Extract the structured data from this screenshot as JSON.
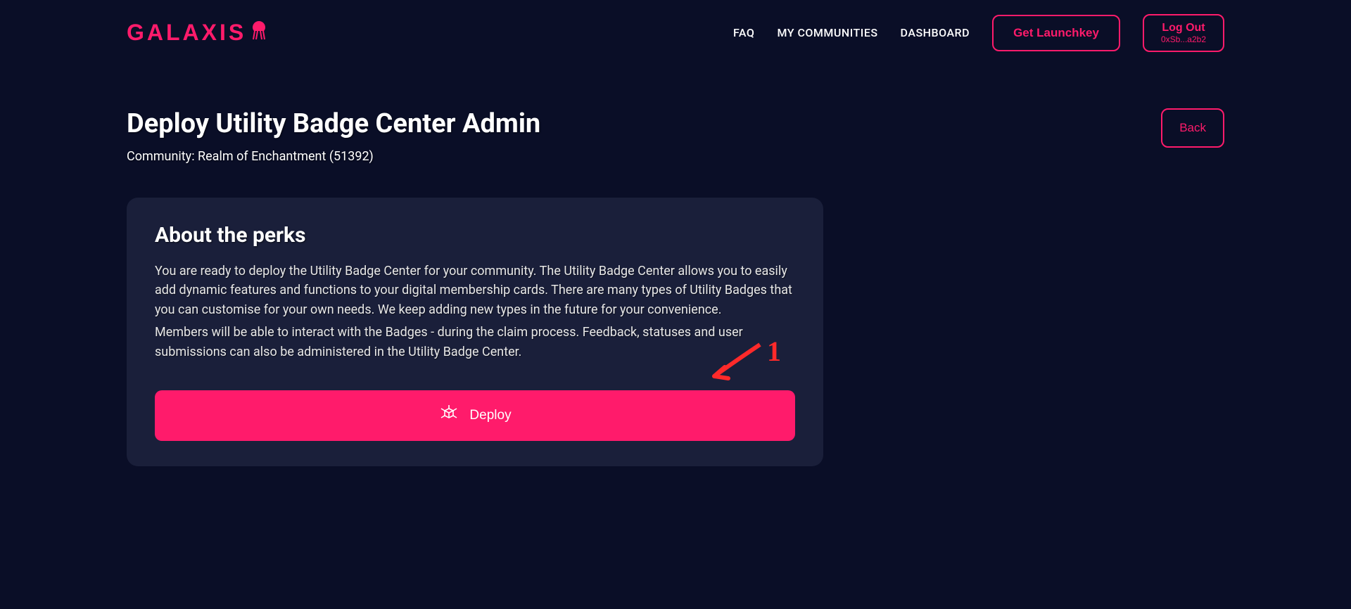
{
  "logo": {
    "text": "GALAXIS"
  },
  "nav": {
    "faq": "FAQ",
    "my_communities": "MY COMMUNITIES",
    "dashboard": "DASHBOARD",
    "get_launchkey": "Get Launchkey",
    "logout": "Log Out",
    "logout_wallet": "0xSb...a2b2"
  },
  "page": {
    "title": "Deploy Utility Badge Center Admin",
    "subtitle": "Community: Realm of Enchantment (51392)",
    "back": "Back"
  },
  "card": {
    "title": "About the perks",
    "p1": "You are ready to deploy the Utility Badge Center for your community. The Utility Badge Center allows you to easily add dynamic features and functions to your digital membership cards. There are many types of Utility Badges that you can customise for your own needs. We keep adding new types in the future for your convenience.",
    "p2": "Members will be able to interact with the Badges - during the claim process. Feedback, statuses and user submissions can also be administered in the Utility Badge Center.",
    "deploy": "Deploy"
  },
  "annotation": {
    "num": "1"
  },
  "colors": {
    "accent": "#ff1b6b",
    "bg": "#0a0e27",
    "card": "#1a1f3a"
  }
}
